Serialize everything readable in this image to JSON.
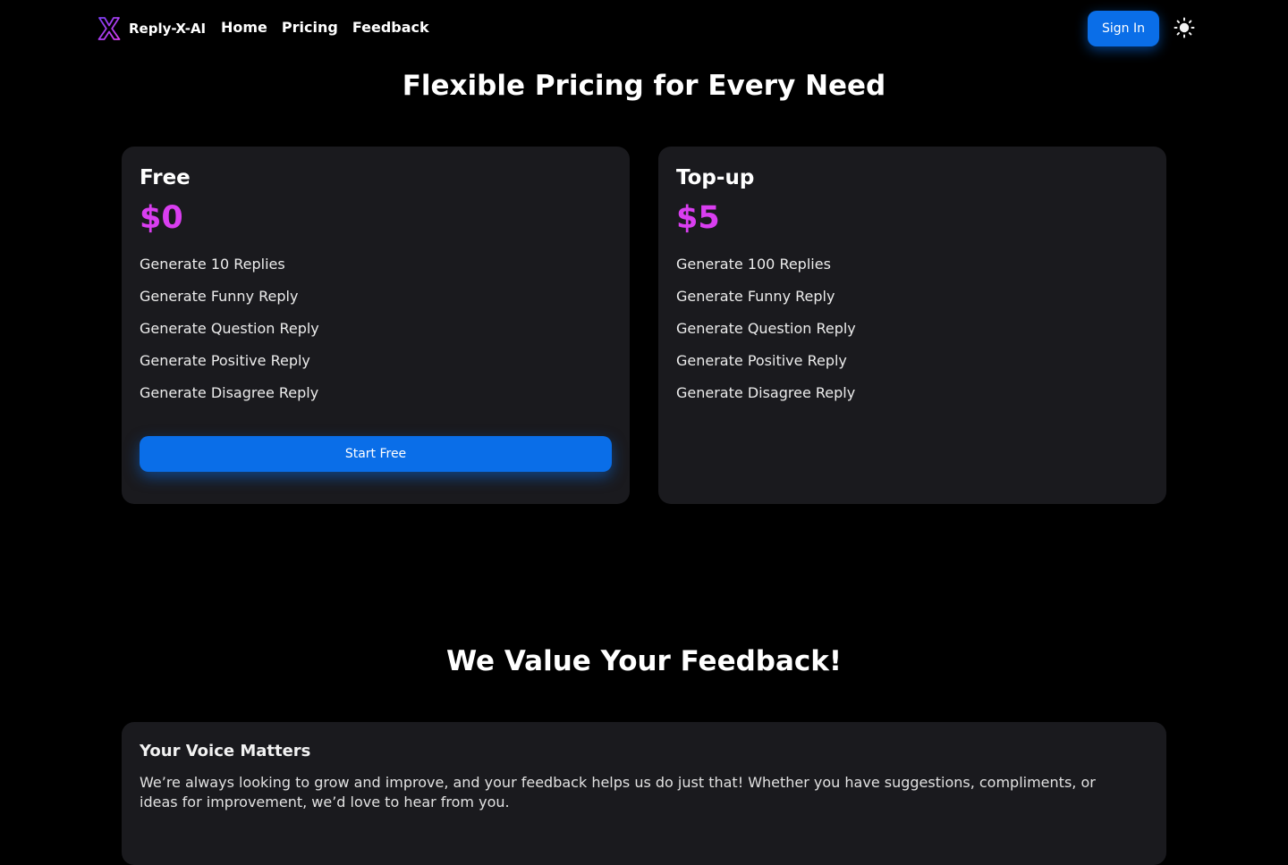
{
  "nav": {
    "brand": "Reply-X-AI",
    "links": [
      "Home",
      "Pricing",
      "Feedback"
    ],
    "signin_label": "Sign In",
    "theme_icon": "sun-icon",
    "brand_color": "#b23ee8"
  },
  "pricing": {
    "title": "Flexible Pricing for Every Need",
    "plans": [
      {
        "name": "Free",
        "price": "$0",
        "features": [
          "Generate 10 Replies",
          "Generate Funny Reply",
          "Generate Question Reply",
          "Generate Positive Reply",
          "Generate Disagree Reply"
        ],
        "button_label": "Start Free"
      },
      {
        "name": "Top-up",
        "price": "$5",
        "features": [
          "Generate 100 Replies",
          "Generate Funny Reply",
          "Generate Question Reply",
          "Generate Positive Reply",
          "Generate Disagree Reply"
        ]
      }
    ]
  },
  "feedback": {
    "title": "We Value Your Feedback!",
    "heading": "Your Voice Matters",
    "text": "We’re always looking to grow and improve, and your feedback helps us do just that! Whether you have suggestions, compliments, or ideas for improvement, we’d love to hear from you."
  },
  "colors": {
    "accent": "#0a6ee8",
    "price": "#d93ef0",
    "card_bg": "#1a1a1e",
    "page_bg": "#000000"
  }
}
